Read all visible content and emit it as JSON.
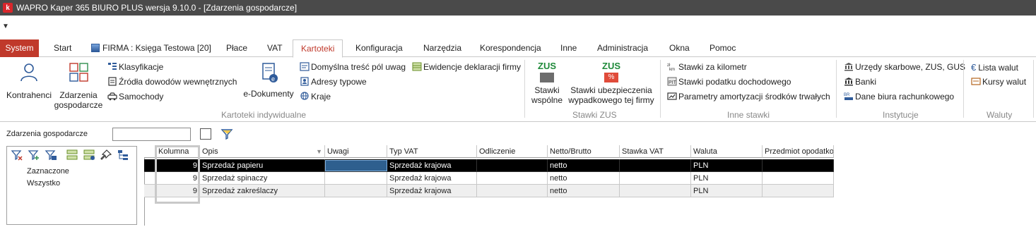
{
  "window": {
    "title": "WAPRO Kaper 365 BIURO PLUS wersja 9.10.0 - [Zdarzenia gospodarcze]",
    "app_icon_letter": "k"
  },
  "menu": {
    "tabs": [
      "System",
      "Start",
      "FIRMA : Księga Testowa [20]",
      "Płace",
      "VAT",
      "Kartoteki",
      "Konfiguracja",
      "Narzędzia",
      "Korespondencja",
      "Inne",
      "Administracja",
      "Okna",
      "Pomoc"
    ],
    "active_tab": "Kartoteki"
  },
  "ribbon": {
    "kartoteki": {
      "kontrahenci": "Kontrahenci",
      "zdarzenia_line1": "Zdarzenia",
      "zdarzenia_line2": "gospodarcze",
      "klasyfikacje": "Klasyfikacje",
      "zrodla": "Źródła dowodów wewnętrznych",
      "samochody": "Samochody",
      "edokumenty": "e-Dokumenty",
      "domyslna": "Domyślna treść pól uwag",
      "adresy": "Adresy typowe",
      "kraje": "Kraje",
      "ewidencje": "Ewidencje deklaracji firmy",
      "group": "Kartoteki indywidualne"
    },
    "zus": {
      "badge": "ZUS",
      "badge_pct": "%",
      "wspolne_line1": "Stawki",
      "wspolne_line2": "wspólne",
      "wypadk_line1": "Stawki ubezpieczenia",
      "wypadk_line2": "wypadkowego tej firmy",
      "group": "Stawki ZUS"
    },
    "inne": {
      "km": "Stawki za kilometr",
      "podatek": "Stawki podatku dochodowego",
      "amort": "Parametry amortyzacji środków trwałych",
      "group": "Inne stawki"
    },
    "instytucje": {
      "urzedy": "Urzędy skarbowe, ZUS, GUS",
      "banki": "Banki",
      "biuro": "Dane biura rachunkowego",
      "group": "Instytucje"
    },
    "waluty": {
      "lista": "Lista walut",
      "kursy": "Kursy walut",
      "group": "Waluty"
    }
  },
  "filter": {
    "label": "Zdarzenia gospodarcze",
    "value": ""
  },
  "left_panel": {
    "items": [
      "Zaznaczone",
      "Wszystko"
    ]
  },
  "grid": {
    "headers": [
      "Kolumna",
      "Opis",
      "Uwagi",
      "Typ VAT",
      "Odliczenie",
      "Netto/Brutto",
      "Stawka VAT",
      "Waluta",
      "Przedmiot opodatko"
    ],
    "rows": [
      [
        "9",
        "Sprzedaż papieru",
        "",
        "Sprzedaż krajowa",
        "",
        "netto",
        "",
        "PLN",
        ""
      ],
      [
        "9",
        "Sprzedaż spinaczy",
        "",
        "Sprzedaż krajowa",
        "",
        "netto",
        "",
        "PLN",
        ""
      ],
      [
        "9",
        "Sprzedaż zakreślaczy",
        "",
        "Sprzedaż krajowa",
        "",
        "netto",
        "",
        "PLN",
        ""
      ]
    ]
  },
  "colors": {
    "accent": "#c0392b",
    "titlebar": "#4a4a4a",
    "selected_row": "#000000",
    "zus_green": "#1f8a3a"
  }
}
